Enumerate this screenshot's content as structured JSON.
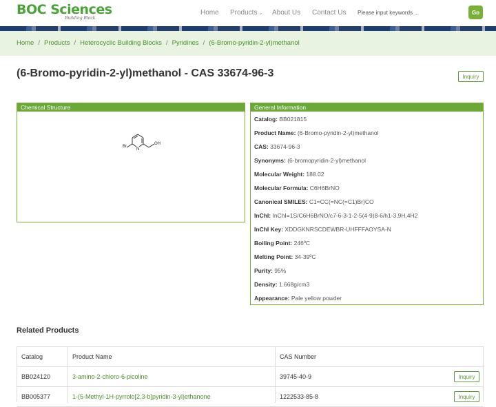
{
  "header": {
    "logo_text": "BOC Sciences",
    "logo_tagline": "Building Block",
    "nav": [
      "Home",
      "Products",
      "About Us",
      "Contact Us"
    ],
    "search_placeholder": "Please input keywords ...",
    "go_label": "Go"
  },
  "breadcrumb": [
    "Home",
    "Products",
    "Heterocyclic Building Blocks",
    "Pyridines",
    "(6-Bromo-pyridin-2-yl)methanol"
  ],
  "page": {
    "title": "(6-Bromo-pyridin-2-yl)methanol - CAS 33674-96-3",
    "inquiry_label": "Inquiry"
  },
  "structure": {
    "header": "Chemical Structure",
    "atom_br": "Br",
    "atom_n": "N",
    "atom_oh": "OH"
  },
  "info": {
    "header": "General Information",
    "rows": [
      {
        "label": "Catalog:",
        "value": "BB021815"
      },
      {
        "label": "Product Name:",
        "value": "(6-Bromo-pyridin-2-yl)methanol"
      },
      {
        "label": "CAS:",
        "value": "33674-96-3"
      },
      {
        "label": "Synonyms:",
        "value": "(6-bromopyridin-2-yl)methanol"
      },
      {
        "label": "Molecular Weight:",
        "value": "188.02"
      },
      {
        "label": "Molecular Formula:",
        "value": "C6H6BrNO"
      },
      {
        "label": "Canonical SMILES:",
        "value": "C1=CC(=NC(=C1)Br)CO"
      },
      {
        "label": "InChI:",
        "value": "InChI=1S/C6H6BrNO/c7-6-3-1-2-5(4-9)8-6/h1-3,9H,4H2"
      },
      {
        "label": "InChI Key:",
        "value": "XDDGKNRSCDEWBR-UHFFFAOYSA-N"
      },
      {
        "label": "Boiling Point:",
        "value": "246ºC"
      },
      {
        "label": "Melting Point:",
        "value": "34-39ºC"
      },
      {
        "label": "Purity:",
        "value": "95%"
      },
      {
        "label": "Density:",
        "value": "1.668g/cm3"
      },
      {
        "label": "Appearance:",
        "value": "Pale yellow powder"
      }
    ]
  },
  "related": {
    "title": "Related Products",
    "columns": [
      "Catalog",
      "Product Name",
      "CAS Number"
    ],
    "rows": [
      {
        "catalog": "BB024120",
        "name": "3-amino-2-chloro-6-picoline",
        "cas": "39745-40-9",
        "action": "Inquiry"
      },
      {
        "catalog": "BB005377",
        "name": "1-(5-Methyl-1H-pyrrolo[2,3-b]pyridin-3-yl)ethanone",
        "cas": "1222533-85-8",
        "action": "Inquiry"
      }
    ]
  }
}
